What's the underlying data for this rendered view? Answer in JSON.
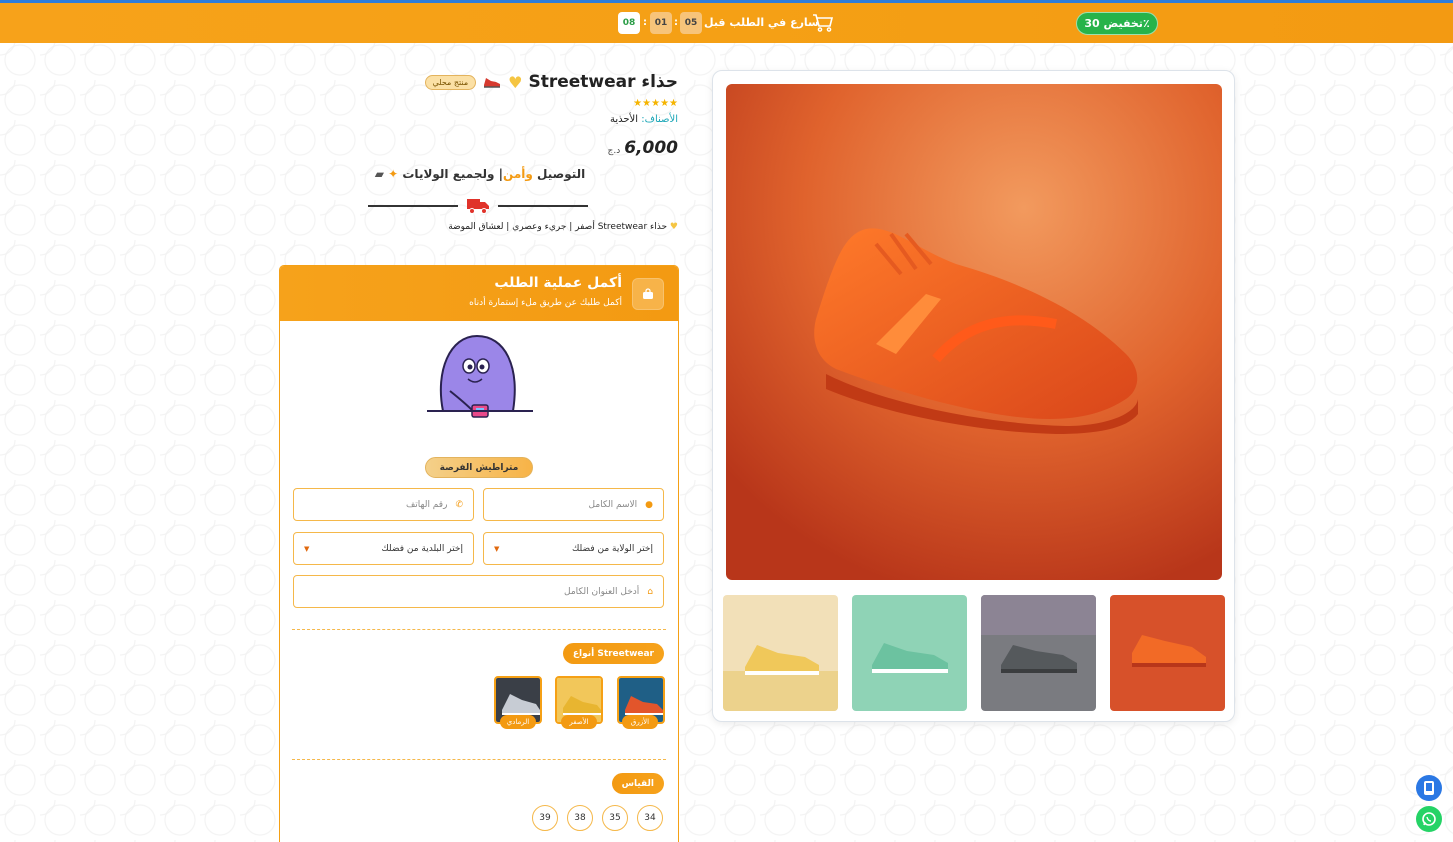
{
  "topbar": {
    "discount": "تخفيض 30٪",
    "hurry_text": "سارع في الطلب قبل",
    "timer": {
      "minutes": "05",
      "seconds": "01",
      "ms": "08"
    }
  },
  "product": {
    "title": "حذاء Streetwear",
    "local_badge": "منتج محلي",
    "stars": "★★★★★",
    "category_label": "الأصناف:",
    "category_value": "الأحذية",
    "price": "6,000",
    "currency": "د.ج",
    "delivery_part1": "التوصيل",
    "delivery_part2": "وأمن",
    "delivery_part3": "ولجميع الولايات",
    "tagline": "حذاء Streetwear أصفر | جريء وعصري | لعشاق الموضة"
  },
  "form": {
    "title": "أكمل عملية الطلب",
    "subtitle": "أكمل طلبك عن طريق ملء إستمارة أدناه",
    "opportunity": "متراطيش الفرصة",
    "name_placeholder": "الاسم الكامل",
    "phone_placeholder": "رقم الهاتف",
    "wilaya": "إختر الولاية من فضلك",
    "baladiya": "إختر البلدية من فضلك",
    "address_placeholder": "أدخل العنوان الكامل",
    "types_label": "أنواع Streetwear",
    "variants": [
      "الأزرق",
      "الأصفر",
      "الرمادي"
    ],
    "size_label": "القياس",
    "sizes": [
      "34",
      "35",
      "38",
      "39"
    ]
  },
  "colors": {
    "accent": "#f39a12",
    "discount_green": "#27b34a",
    "link_teal": "#1ba6b7"
  },
  "icons": [
    "cart-icon",
    "truck-icon",
    "bag-icon",
    "user-icon",
    "phone-icon",
    "home-icon",
    "whatsapp-icon",
    "mobile-icon"
  ]
}
